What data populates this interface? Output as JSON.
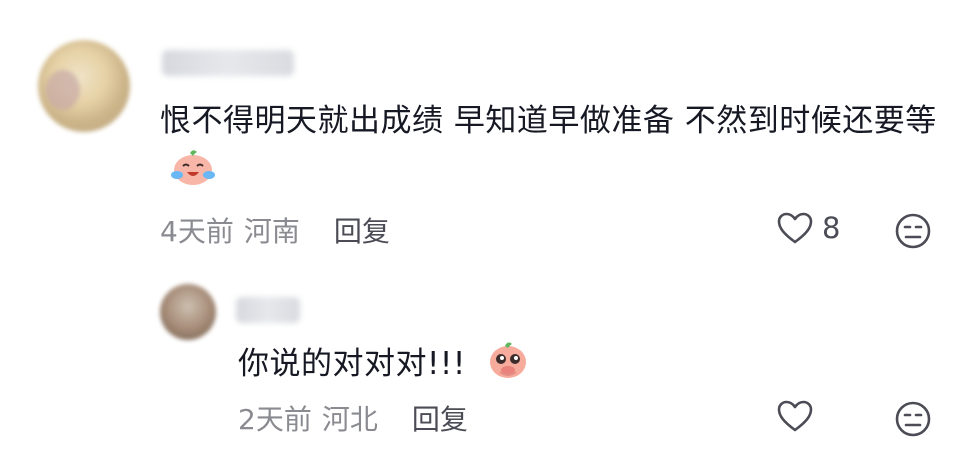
{
  "comments": [
    {
      "text": "恨不得明天就出成绩 早知道早做准备 不然到时候还要等",
      "emoji": "crying-laughing-peach-emoji",
      "time": "4天前",
      "location": "河南",
      "reply_label": "回复",
      "like_count": "8"
    },
    {
      "text": "你说的对对对!!!",
      "emoji": "pleading-peach-emoji",
      "time": "2天前",
      "location": "河北",
      "reply_label": "回复",
      "like_count": ""
    }
  ],
  "icons": {
    "like": "heart-outline-icon",
    "dislike": "neutral-face-icon"
  },
  "colors": {
    "text": "#161823",
    "meta": "#8a8b91",
    "icon": "#4b4c55",
    "peach": "#f4a99b"
  }
}
